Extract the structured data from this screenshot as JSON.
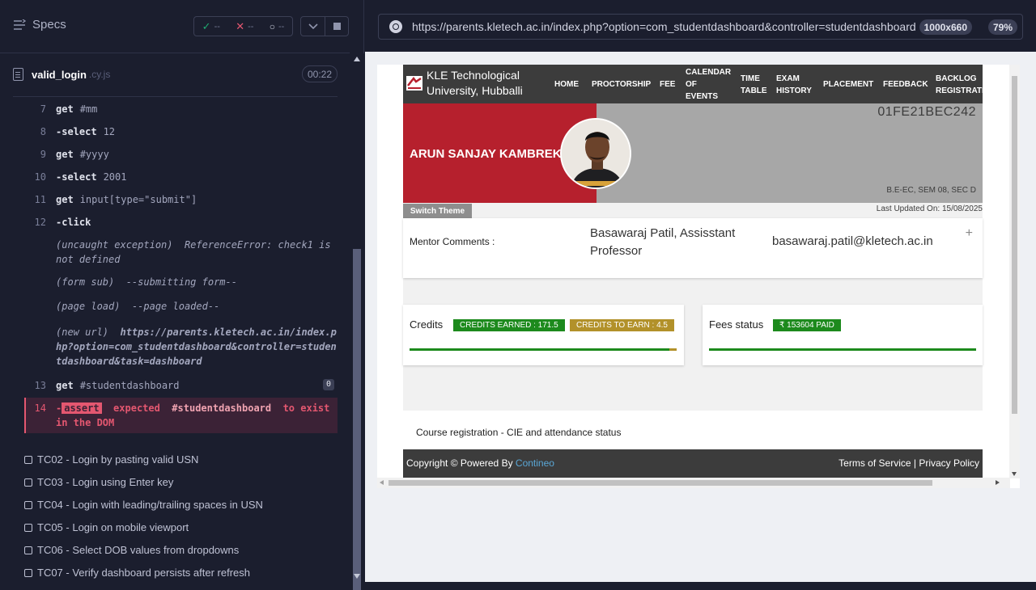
{
  "reporter": {
    "specs_label": "Specs",
    "stats": {
      "passed": "--",
      "failed": "--",
      "pending": "--"
    },
    "spec_name": "valid_login",
    "spec_ext": ".cy.js",
    "duration": "00:22",
    "commands": [
      {
        "num": "7",
        "name": "get",
        "arg": "#mm"
      },
      {
        "num": "8",
        "name": "-select",
        "arg": "12"
      },
      {
        "num": "9",
        "name": "get",
        "arg": "#yyyy"
      },
      {
        "num": "10",
        "name": "-select",
        "arg": "2001"
      },
      {
        "num": "11",
        "name": "get",
        "arg": "input[type=\"submit\"]"
      },
      {
        "num": "12",
        "name": "-click",
        "arg": ""
      }
    ],
    "logs": [
      {
        "label": "(uncaught exception)",
        "text": "ReferenceError: check1 is not defined"
      },
      {
        "label": "(form sub)",
        "text": "--submitting form--"
      },
      {
        "label": "(page load)",
        "text": "--page loaded--"
      },
      {
        "label": "(new url)",
        "text": "https://parents.kletech.ac.in/index.php?option=com_studentdashboard&controller=studentdashboard&task=dashboard"
      }
    ],
    "command_13": {
      "num": "13",
      "name": "get",
      "arg": "#studentdashboard",
      "badge": "0"
    },
    "command_14": {
      "num": "14",
      "prefix": "-",
      "name": "assert",
      "expected": "expected",
      "selector": "#studentdashboard",
      "tail": "to exist in the DOM"
    },
    "tests": [
      "TC02 - Login by pasting valid USN",
      "TC03 - Login using Enter key",
      "TC04 - Login with leading/trailing spaces in USN",
      "TC05 - Login on mobile viewport",
      "TC06 - Select DOB values from dropdowns",
      "TC07 - Verify dashboard persists after refresh"
    ]
  },
  "aut": {
    "url": "https://parents.kletech.ac.in/index.php?option=com_studentdashboard&controller=studentdashboard",
    "viewport": "1000x660",
    "zoom": "79%"
  },
  "site": {
    "university": [
      "KLE Technological",
      "University, Hubballi"
    ],
    "nav": [
      {
        "lines": [
          "HOME"
        ]
      },
      {
        "lines": [
          "PROCTORSHIP"
        ]
      },
      {
        "lines": [
          "FEE"
        ]
      },
      {
        "lines": [
          "CALENDAR",
          "OF",
          "EVENTS"
        ]
      },
      {
        "lines": [
          "TIME",
          "TABLE"
        ]
      },
      {
        "lines": [
          "EXAM",
          "HISTORY"
        ]
      },
      {
        "lines": [
          "PLACEMENT"
        ]
      },
      {
        "lines": [
          "FEEDBACK"
        ]
      },
      {
        "lines": [
          "BACKLOG",
          "REGISTRATION"
        ]
      }
    ],
    "student_name": "ARUN SANJAY KAMBREKAR",
    "usn": "01FE21BEC242",
    "program": "B.E-EC, SEM 08, SEC D",
    "switch_theme": "Switch Theme",
    "last_updated": "Last Updated On: 15/08/2025",
    "mentor_label": "Mentor Comments :",
    "mentor_name": "Basawaraj Patil, Assisstant Professor",
    "mentor_email": "basawaraj.patil@kletech.ac.in",
    "expand_symbol": "+",
    "credits": {
      "title": "Credits",
      "earned": "CREDITS EARNED : 171.5",
      "to_earn": "CREDITS TO EARN : 4.5",
      "earned_fraction": 0.974
    },
    "fees": {
      "title": "Fees status",
      "paid": "₹ 153604 PAID",
      "paid_fraction": 1.0
    },
    "course_registration": "Course registration - CIE and attendance status",
    "footer_left_prefix": "Copyright © Powered By",
    "footer_brand": "Contineo",
    "footer_right": "Terms of Service | Privacy Policy",
    "colors": {
      "red": "#b6202d",
      "green": "#1d8a1d",
      "gold": "#b2912a",
      "dark": "#3c3c3c"
    }
  }
}
